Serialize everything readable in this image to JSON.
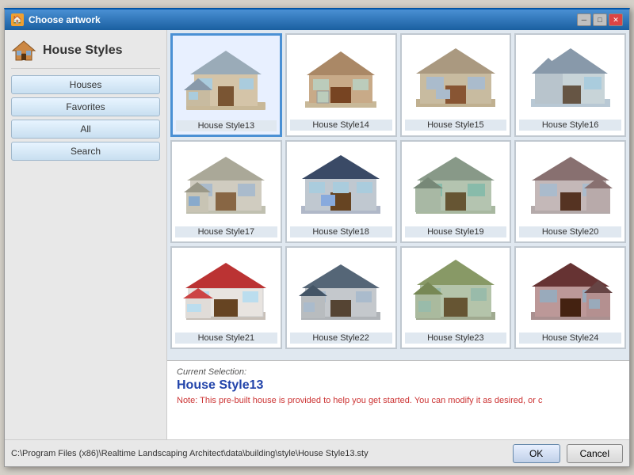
{
  "dialog": {
    "title": "Choose artwork",
    "title_icon": "🏠"
  },
  "sidebar": {
    "title": "House Styles",
    "buttons": [
      {
        "label": "Houses",
        "id": "houses"
      },
      {
        "label": "Favorites",
        "id": "favorites"
      },
      {
        "label": "All",
        "id": "all"
      },
      {
        "label": "Search",
        "id": "search"
      }
    ]
  },
  "grid": {
    "items": [
      {
        "label": "House Style13",
        "selected": true
      },
      {
        "label": "House Style14",
        "selected": false
      },
      {
        "label": "House Style15",
        "selected": false
      },
      {
        "label": "House Style16",
        "selected": false
      },
      {
        "label": "House Style17",
        "selected": false
      },
      {
        "label": "House Style18",
        "selected": false
      },
      {
        "label": "House Style19",
        "selected": false
      },
      {
        "label": "House Style20",
        "selected": false
      },
      {
        "label": "House Style21",
        "selected": false
      },
      {
        "label": "House Style22",
        "selected": false
      },
      {
        "label": "House Style23",
        "selected": false
      },
      {
        "label": "House Style24",
        "selected": false
      }
    ]
  },
  "info": {
    "label": "Current Selection:",
    "selection": "House Style13",
    "note_prefix": "Note: ",
    "note_text": "This pre-built house is provided to help you get started. You can modify it as desired, or c"
  },
  "footer": {
    "file_path": "C:\\Program Files (x86)\\Realtime Landscaping Architect\\data\\building\\style\\House Style13.sty",
    "ok_label": "OK",
    "cancel_label": "Cancel"
  },
  "title_buttons": [
    {
      "label": "─",
      "id": "minimize"
    },
    {
      "label": "□",
      "id": "maximize"
    },
    {
      "label": "✕",
      "id": "close"
    }
  ]
}
